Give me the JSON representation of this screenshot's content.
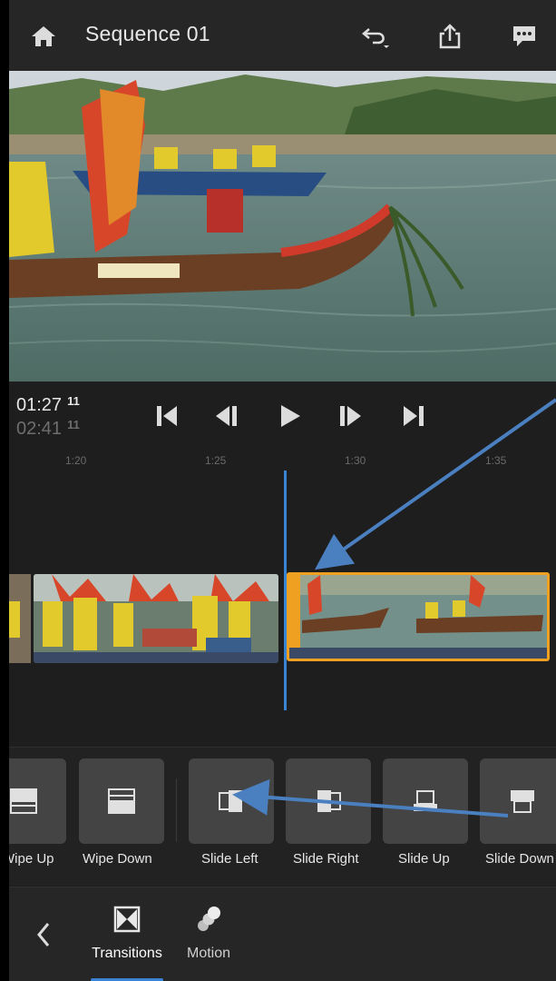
{
  "header": {
    "title": "Sequence 01",
    "icons": [
      "home-icon",
      "undo-icon",
      "share-icon",
      "feedback-icon"
    ]
  },
  "transport": {
    "current_time": "01:27",
    "current_frame": "11",
    "total_time": "02:41",
    "total_frame": "11",
    "buttons": [
      "go-to-start-icon",
      "step-back-icon",
      "play-icon",
      "step-forward-icon",
      "go-to-end-icon"
    ]
  },
  "ruler": {
    "ticks": [
      "1:20",
      "1:25",
      "1:30",
      "1:35"
    ]
  },
  "transitions": {
    "items": [
      {
        "label": "Wipe Up",
        "icon": "wipe-up-icon"
      },
      {
        "label": "Wipe Down",
        "icon": "wipe-down-icon"
      },
      {
        "label": "Slide Left",
        "icon": "slide-left-icon"
      },
      {
        "label": "Slide Right",
        "icon": "slide-right-icon"
      },
      {
        "label": "Slide Up",
        "icon": "slide-up-icon"
      },
      {
        "label": "Slide Down",
        "icon": "slide-down-icon"
      }
    ]
  },
  "bottom_nav": {
    "back_icon": "chevron-left-icon",
    "tabs": [
      {
        "label": "Transitions",
        "icon": "transitions-icon",
        "active": true
      },
      {
        "label": "Motion",
        "icon": "motion-icon",
        "active": false
      }
    ]
  },
  "colors": {
    "accent": "#3a84d6",
    "selection": "#f0a020",
    "background": "#1e1e1e",
    "tile": "#444444"
  }
}
